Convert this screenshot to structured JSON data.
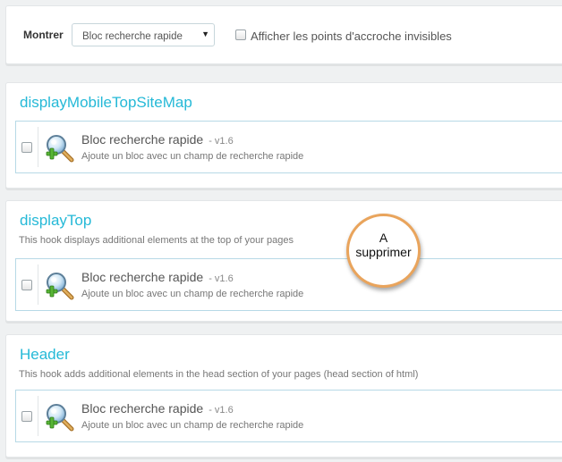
{
  "filter": {
    "label": "Montrer",
    "selected": "Bloc recherche rapide",
    "arrow": "▼",
    "show_hidden_label": "Afficher les points d'accroche invisibles"
  },
  "hooks": [
    {
      "title": "displayMobileTopSiteMap",
      "description": "",
      "module": {
        "name": "Bloc recherche rapide",
        "version": "- v1.6",
        "description": "Ajoute un bloc avec un champ de recherche rapide"
      }
    },
    {
      "title": "displayTop",
      "description": "This hook displays additional elements at the top of your pages",
      "module": {
        "name": "Bloc recherche rapide",
        "version": "- v1.6",
        "description": "Ajoute un bloc avec un champ de recherche rapide"
      }
    },
    {
      "title": "Header",
      "description": "This hook adds additional elements in the head section of your pages (head section of html)",
      "module": {
        "name": "Bloc recherche rapide",
        "version": "- v1.6",
        "description": "Ajoute un bloc avec un champ de recherche rapide"
      }
    }
  ],
  "annotation": {
    "line1": "A",
    "line2": "supprimer"
  },
  "colors": {
    "hook_title": "#25b9d7",
    "annotation_border": "#e9a45c",
    "row_border": "#b7d9e6"
  },
  "icons": {
    "module": "magnifier-plus-icon",
    "select_arrow": "chevron-down-icon"
  }
}
